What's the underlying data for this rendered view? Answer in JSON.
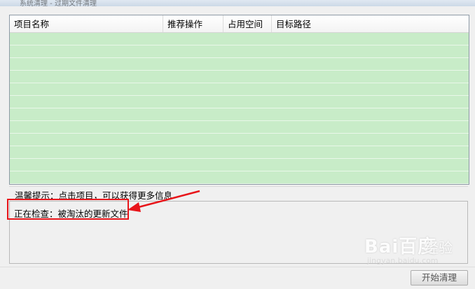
{
  "window": {
    "title": "系统清理 - 过期文件清理"
  },
  "table": {
    "columns": [
      "项目名称",
      "推荐操作",
      "占用空间",
      "目标路径"
    ],
    "row_count": 12,
    "row_color": "#c8ecc8"
  },
  "tip": {
    "text": "温馨提示：点击项目，可以获得更多信息"
  },
  "status": {
    "text": "正在检查：被淘汰的更新文件"
  },
  "annotation": {
    "color": "#e8151a"
  },
  "buttons": {
    "start_clean": "开始清理"
  },
  "watermark": {
    "logo": "Bai百度",
    "brand": "经验",
    "url": "jingyan.baidu.com"
  }
}
